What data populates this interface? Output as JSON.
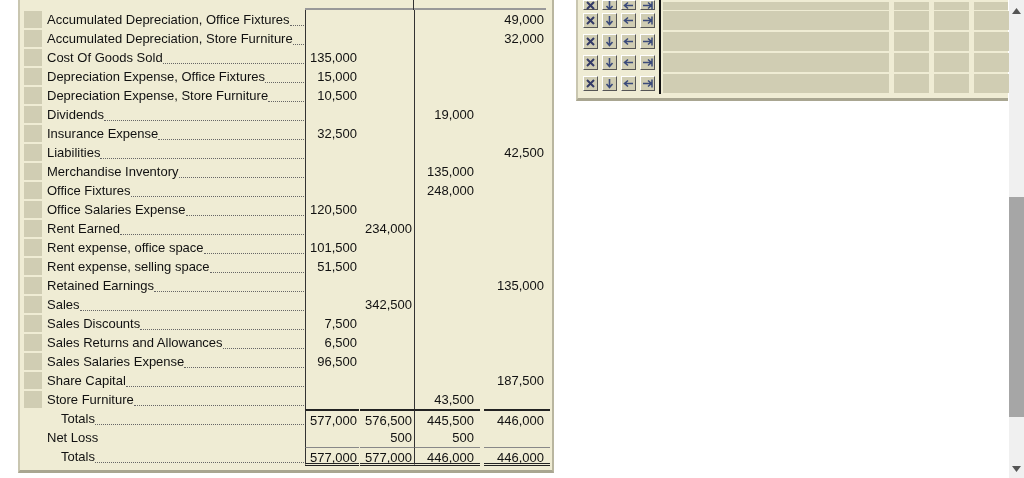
{
  "worksheet": {
    "rows": [
      {
        "kind": "account",
        "label": "Accumulated Depreciation, Office Fixtures",
        "column_4": "49,000"
      },
      {
        "kind": "account",
        "label": "Accumulated Depreciation, Store Furniture",
        "column_4": "32,000"
      },
      {
        "kind": "account",
        "label": "Cost Of Goods Sold",
        "column_1": "135,000"
      },
      {
        "kind": "account",
        "label": "Depreciation Expense, Office Fixtures",
        "column_1": "15,000"
      },
      {
        "kind": "account",
        "label": "Depreciation Expense, Store Furniture",
        "column_1": "10,500"
      },
      {
        "kind": "account",
        "label": "Dividends",
        "column_3": "19,000"
      },
      {
        "kind": "account",
        "label": "Insurance Expense",
        "column_1": "32,500"
      },
      {
        "kind": "account",
        "label": "Liabilities",
        "column_4": "42,500"
      },
      {
        "kind": "account",
        "label": "Merchandise Inventory",
        "column_3": "135,000"
      },
      {
        "kind": "account",
        "label": "Office Fixtures",
        "column_3": "248,000"
      },
      {
        "kind": "account",
        "label": "Office Salaries Expense",
        "column_1": "120,500"
      },
      {
        "kind": "account",
        "label": "Rent Earned",
        "column_2": "234,000"
      },
      {
        "kind": "account",
        "label": "Rent expense, office space",
        "column_1": "101,500"
      },
      {
        "kind": "account",
        "label": "Rent expense, selling space",
        "column_1": "51,500"
      },
      {
        "kind": "account",
        "label": "Retained Earnings",
        "column_4": "135,000"
      },
      {
        "kind": "account",
        "label": "Sales",
        "column_2": "342,500"
      },
      {
        "kind": "account",
        "label": "Sales Discounts",
        "column_1": "7,500"
      },
      {
        "kind": "account",
        "label": "Sales Returns and Allowances",
        "column_1": "6,500"
      },
      {
        "kind": "account",
        "label": "Sales Salaries Expense",
        "column_1": "96,500"
      },
      {
        "kind": "account",
        "label": "Share Capital",
        "column_4": "187,500"
      },
      {
        "kind": "account",
        "label": "Store Furniture",
        "column_3": "43,500"
      },
      {
        "kind": "subtotal",
        "label": "Totals",
        "column_1": "577,000",
        "column_2": "576,500",
        "column_3": "445,500",
        "column_4": "446,000"
      },
      {
        "kind": "netloss",
        "label": "Net Loss",
        "column_2": "500",
        "column_3": "500"
      },
      {
        "kind": "total",
        "label": "Totals",
        "column_1": "577,000",
        "column_2": "577,000",
        "column_3": "446,000",
        "column_4": "446,000"
      }
    ]
  },
  "entry_panel": {
    "rows": [
      {
        "kind": "partial"
      },
      {
        "kind": "entry"
      },
      {
        "kind": "entry"
      },
      {
        "kind": "entry"
      },
      {
        "kind": "entry"
      }
    ]
  }
}
